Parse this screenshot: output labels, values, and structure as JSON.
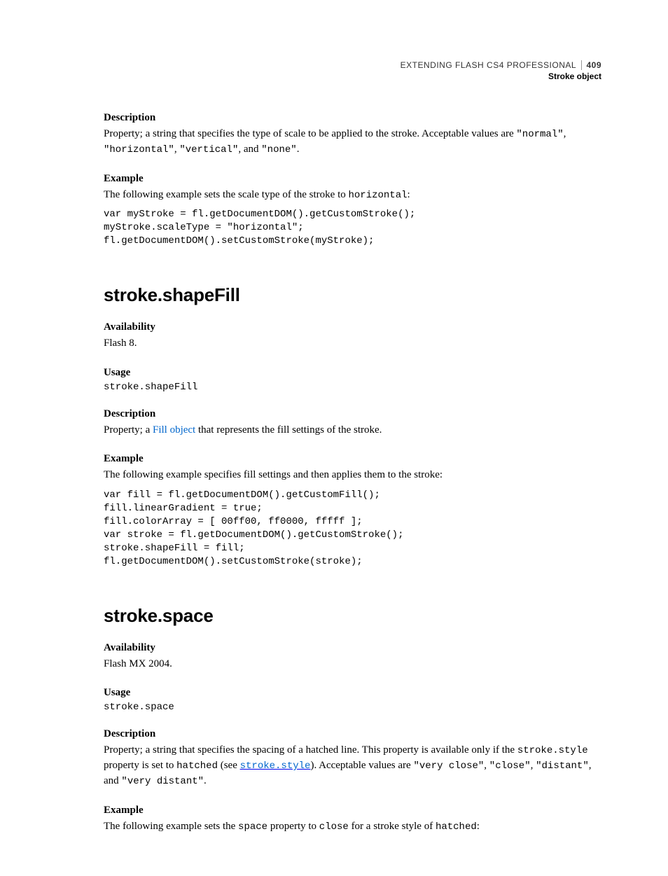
{
  "header": {
    "title": "EXTENDING FLASH CS4 PROFESSIONAL",
    "page": "409",
    "section": "Stroke object"
  },
  "sec1": {
    "h_desc": "Description",
    "desc_a": "Property; a string that specifies the type of scale to be applied to the stroke. Acceptable values are ",
    "v1": "\"normal\"",
    "desc_b": ", ",
    "v2": "\"horizontal\"",
    "desc_c": ", ",
    "v3": "\"vertical\"",
    "desc_d": ", and ",
    "v4": "\"none\"",
    "desc_e": ".",
    "h_ex": "Example",
    "ex_a": "The following example sets the scale type of the stroke to ",
    "ex_code_inline": "horizontal",
    "ex_b": ":",
    "code": "var myStroke = fl.getDocumentDOM().getCustomStroke();\nmyStroke.scaleType = \"horizontal\";\nfl.getDocumentDOM().setCustomStroke(myStroke);"
  },
  "sec2": {
    "title": "stroke.shapeFill",
    "h_avail": "Availability",
    "avail": "Flash 8.",
    "h_usage": "Usage",
    "usage": "stroke.shapeFill",
    "h_desc": "Description",
    "desc_a": "Property; a ",
    "desc_link": "Fill object",
    "desc_b": " that represents the fill settings of the stroke.",
    "h_ex": "Example",
    "ex_a": "The following example specifies fill settings and then applies them to the stroke:",
    "code": "var fill = fl.getDocumentDOM().getCustomFill();\nfill.linearGradient = true;\nfill.colorArray = [ 00ff00, ff0000, fffff ];\nvar stroke = fl.getDocumentDOM().getCustomStroke();\nstroke.shapeFill = fill;\nfl.getDocumentDOM().setCustomStroke(stroke);"
  },
  "sec3": {
    "title": "stroke.space",
    "h_avail": "Availability",
    "avail": "Flash MX 2004.",
    "h_usage": "Usage",
    "usage": "stroke.space",
    "h_desc": "Description",
    "desc_a": "Property; a string that specifies the spacing of a hatched line. This property is available only if the ",
    "c1": "stroke.style",
    "desc_b": " property is set to ",
    "c2": "hatched",
    "desc_c": " (see ",
    "link": "stroke.style",
    "desc_d": "). Acceptable values are ",
    "v1": "\"very close\"",
    "desc_e": ", ",
    "v2": "\"close\"",
    "desc_f": ", ",
    "v3": "\"distant\"",
    "desc_g": ", and ",
    "v4": "\"very distant\"",
    "desc_h": ".",
    "h_ex": "Example",
    "ex_a": "The following example sets the ",
    "ex_c1": "space",
    "ex_b": " property to ",
    "ex_c2": "close",
    "ex_c": " for a stroke style of ",
    "ex_c3": "hatched",
    "ex_d": ":"
  }
}
